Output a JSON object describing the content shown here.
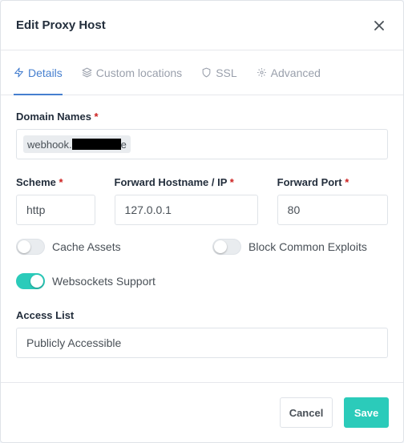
{
  "modal": {
    "title": "Edit Proxy Host",
    "close_label": "×"
  },
  "tabs": [
    {
      "label": "Details",
      "icon": "lightning-icon",
      "active": true
    },
    {
      "label": "Custom locations",
      "icon": "layers-icon",
      "active": false
    },
    {
      "label": "SSL",
      "icon": "shield-icon",
      "active": false
    },
    {
      "label": "Advanced",
      "icon": "gear-icon",
      "active": false
    }
  ],
  "form": {
    "domain_names": {
      "label": "Domain Names",
      "required_mark": "*",
      "chip_prefix": "webhook.",
      "chip_suffix": "e"
    },
    "scheme": {
      "label": "Scheme",
      "required_mark": "*",
      "value": "http"
    },
    "forward_host": {
      "label": "Forward Hostname / IP",
      "required_mark": "*",
      "value": "127.0.0.1"
    },
    "forward_port": {
      "label": "Forward Port",
      "required_mark": "*",
      "value": "80"
    },
    "cache_assets": {
      "label": "Cache Assets",
      "enabled": false
    },
    "block_exploits": {
      "label": "Block Common Exploits",
      "enabled": false
    },
    "websockets": {
      "label": "Websockets Support",
      "enabled": true
    },
    "access_list": {
      "label": "Access List",
      "value": "Publicly Accessible"
    }
  },
  "footer": {
    "cancel_label": "Cancel",
    "save_label": "Save"
  },
  "colors": {
    "accent": "#467fcf",
    "toggle_on": "#2bcbba",
    "required": "#cd201f"
  }
}
